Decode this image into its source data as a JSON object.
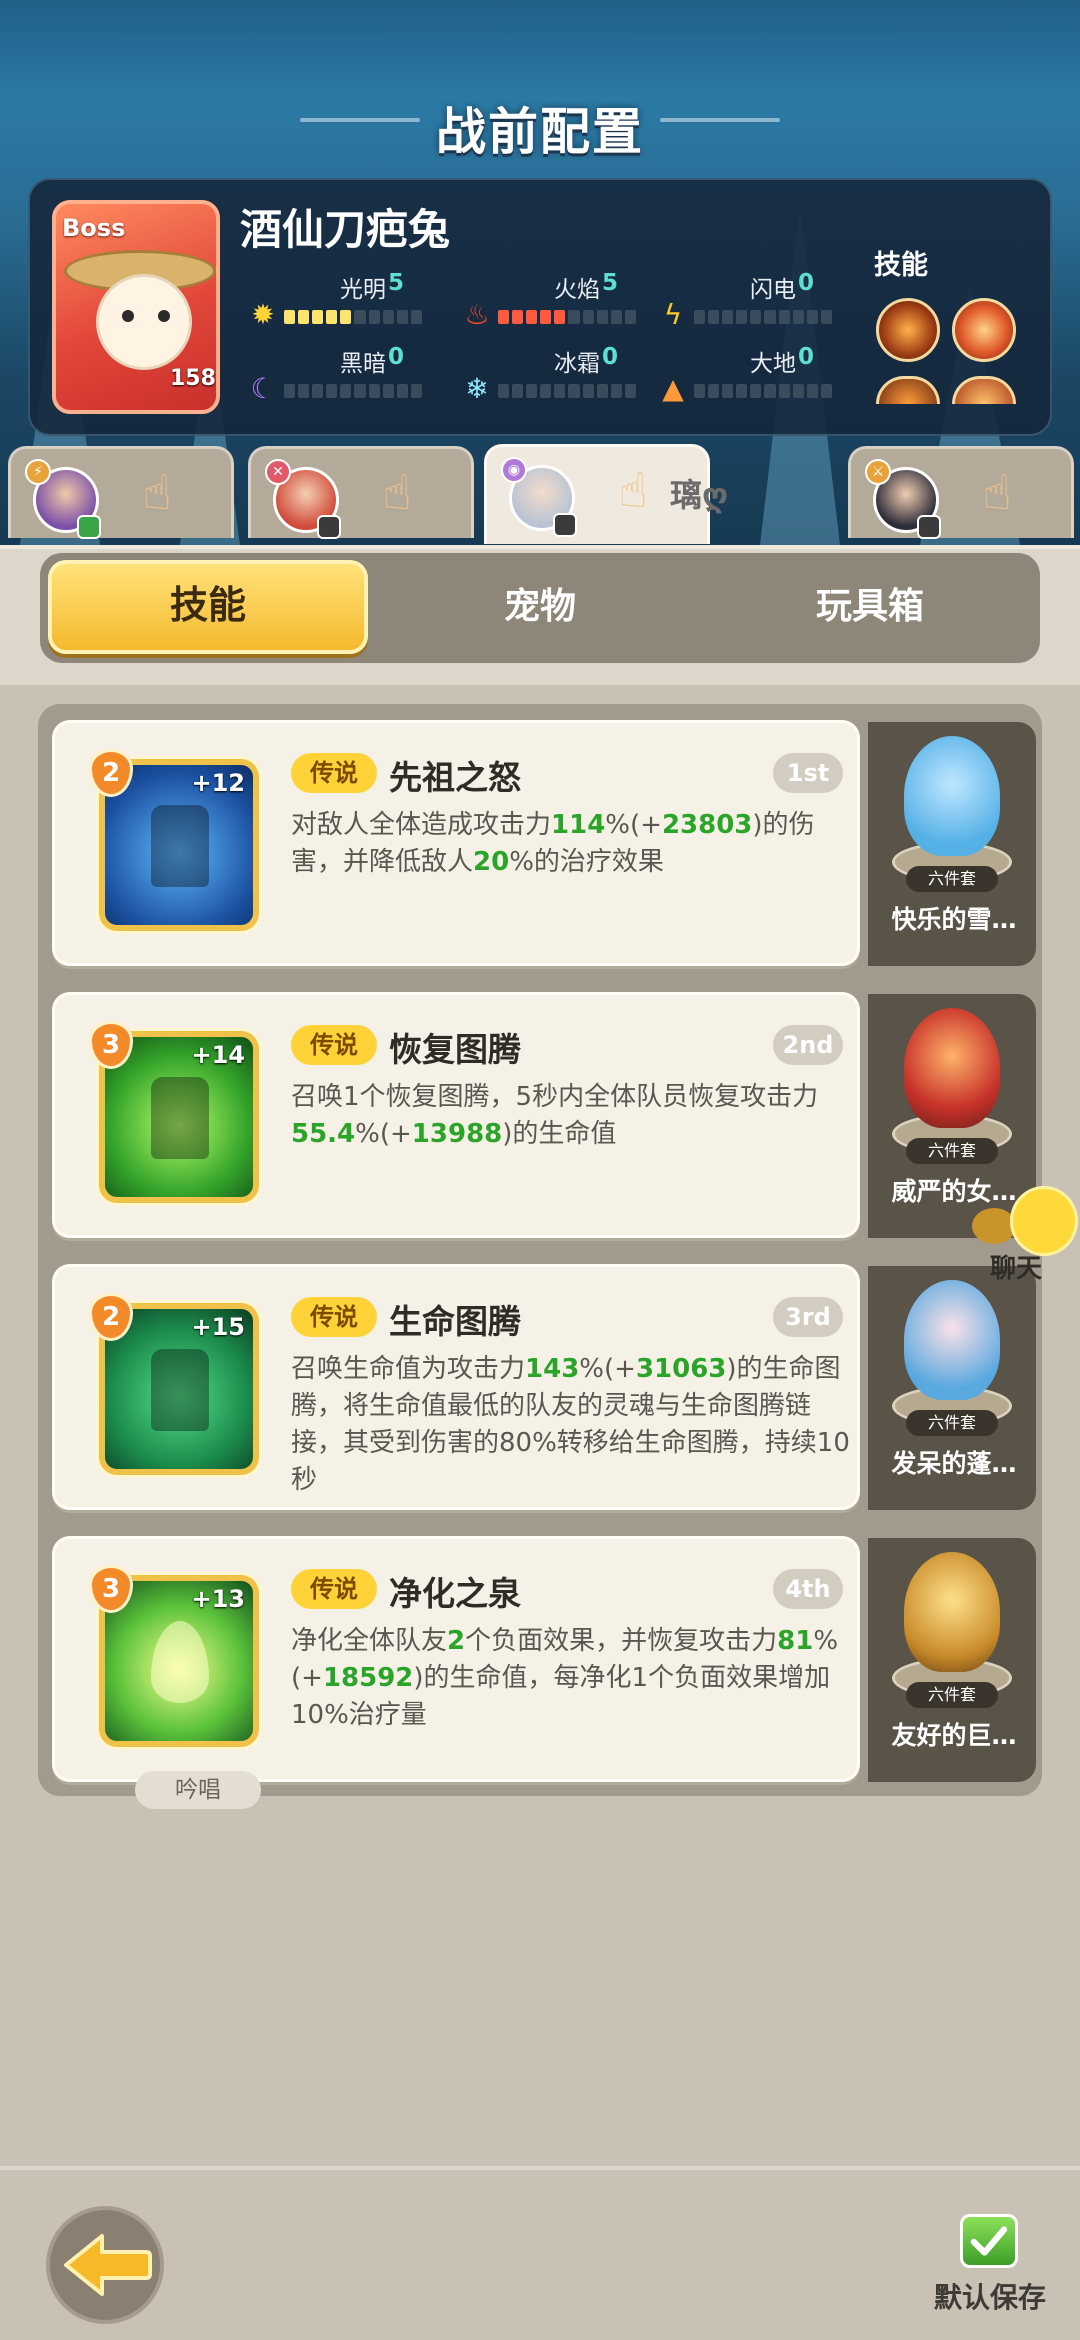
{
  "header": {
    "title": "战前配置"
  },
  "boss": {
    "tag": "Boss",
    "name": "酒仙刀疤兔",
    "level": "158",
    "elements": [
      {
        "name": "光明",
        "value": "5",
        "level_fraction": 0.5,
        "icon": "sun-icon"
      },
      {
        "name": "火焰",
        "value": "5",
        "level_fraction": 0.5,
        "icon": "fire-icon"
      },
      {
        "name": "闪电",
        "value": "0",
        "level_fraction": 0,
        "icon": "lightning-icon"
      },
      {
        "name": "黑暗",
        "value": "0",
        "level_fraction": 0,
        "icon": "moon-icon"
      },
      {
        "name": "冰霜",
        "value": "0",
        "level_fraction": 0,
        "icon": "snowflake-icon"
      },
      {
        "name": "大地",
        "value": "0",
        "level_fraction": 0,
        "icon": "mountain-icon"
      }
    ],
    "skills_label": "技能"
  },
  "heroes": [
    {
      "active": false
    },
    {
      "active": false
    },
    {
      "active": true,
      "name": "璃ღ"
    },
    {
      "active": false
    }
  ],
  "tabs": [
    "技能",
    "宠物",
    "玩具箱"
  ],
  "skills": [
    {
      "level": "2",
      "plus": "+12",
      "badge": "传说",
      "name": "先祖之怒",
      "rank": "1st",
      "desc": [
        "对敌人全体造成攻击力",
        "114",
        "%(+",
        "23803",
        ")的伤害，并降低敌人",
        "20",
        "%的治疗效果"
      ],
      "pet": {
        "name": "快乐的雪…",
        "set": "六件套"
      }
    },
    {
      "level": "3",
      "plus": "+14",
      "badge": "传说",
      "name": "恢复图腾",
      "rank": "2nd",
      "desc": [
        "召唤1个恢复图腾，5秒内全体队员恢复攻击力",
        "55.4",
        "%(+",
        "13988",
        ")的生命值"
      ],
      "pet": {
        "name": "威严的女…",
        "set": "六件套"
      }
    },
    {
      "level": "2",
      "plus": "+15",
      "badge": "传说",
      "name": "生命图腾",
      "rank": "3rd",
      "desc": [
        "召唤生命值为攻击力",
        "143",
        "%(+",
        "31063",
        ")的生命图腾，将生命值最低的队友的灵魂与生命图腾链接，其受到伤害的80%转移给生命图腾，持续10秒"
      ],
      "pet": {
        "name": "发呆的蓬…",
        "set": "六件套"
      }
    },
    {
      "level": "3",
      "plus": "+13",
      "badge": "传说",
      "name": "净化之泉",
      "rank": "4th",
      "desc": [
        "净化全体队友",
        "2",
        "个负面效果，并恢复攻击力",
        "81",
        "%(+",
        "18592",
        ")的生命值，每净化1个负面效果增加10%治疗量"
      ],
      "chant": "吟唱",
      "pet": {
        "name": "友好的巨…",
        "set": "六件套"
      }
    }
  ],
  "chat": {
    "label": "聊天"
  },
  "bottom": {
    "save_label": "默认保存"
  }
}
